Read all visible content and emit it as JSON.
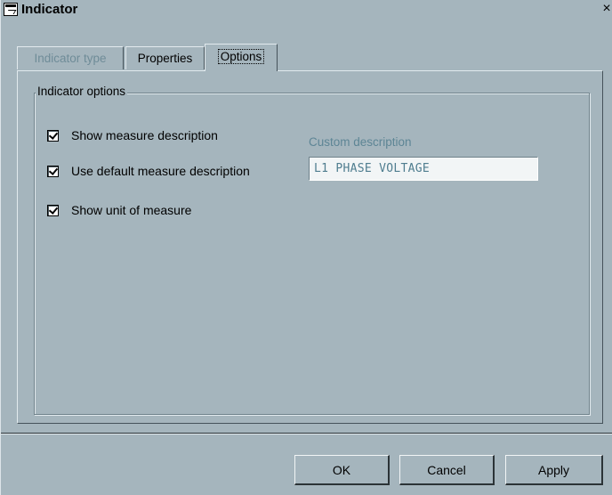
{
  "window": {
    "title": "Indicator",
    "close_glyph": "×",
    "icon": "window-icon"
  },
  "tabs": [
    {
      "label": "Indicator type",
      "state": "disabled"
    },
    {
      "label": "Properties",
      "state": "normal"
    },
    {
      "label": "Options",
      "state": "selected"
    }
  ],
  "options_group": {
    "legend": "Indicator options",
    "checkboxes": [
      {
        "label": "Show measure description",
        "checked": true
      },
      {
        "label": "Use default measure description",
        "checked": true
      },
      {
        "label": "Show unit of measure",
        "checked": true
      }
    ],
    "custom_description": {
      "label": "Custom description",
      "value": "L1 PHASE VOLTAGE"
    }
  },
  "buttons": {
    "ok": "OK",
    "cancel": "Cancel",
    "apply": "Apply"
  },
  "colors": {
    "face": "#a5b5bd",
    "disabled_text": "#6f8c98",
    "input_text": "#4f7d8f"
  }
}
